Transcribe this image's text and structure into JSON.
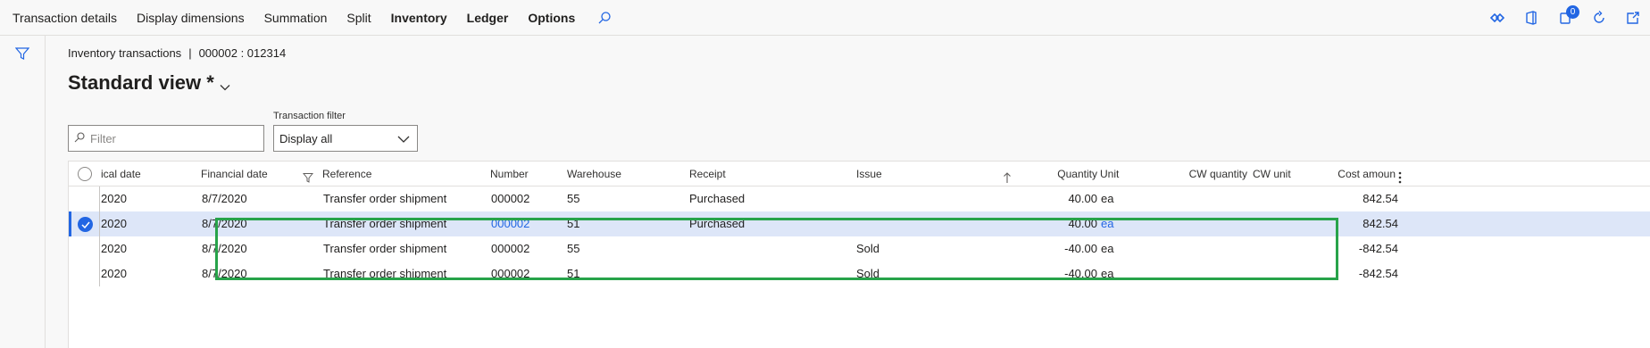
{
  "actionbar": {
    "tabs": [
      {
        "label": "Transaction details",
        "bold": false
      },
      {
        "label": "Display dimensions",
        "bold": false
      },
      {
        "label": "Summation",
        "bold": false
      },
      {
        "label": "Split",
        "bold": false
      },
      {
        "label": "Inventory",
        "bold": true
      },
      {
        "label": "Ledger",
        "bold": true
      },
      {
        "label": "Options",
        "bold": true
      }
    ],
    "search_icon": "search-icon",
    "right_icons": [
      "diamond-arrows-icon",
      "office-icon",
      "notifications-icon",
      "refresh-icon",
      "open-new-window-icon"
    ],
    "notification_count": "0"
  },
  "rail": {
    "icon": "filter-icon"
  },
  "breadcrumb": {
    "section": "Inventory transactions",
    "separator": "|",
    "record": "000002 : 012314"
  },
  "view": {
    "title": "Standard view *"
  },
  "filter": {
    "placeholder": "Filter"
  },
  "transaction_filter": {
    "label": "Transaction filter",
    "value": "Display all"
  },
  "grid": {
    "columns": {
      "physical_date": "ical date",
      "financial_date": "Financial date",
      "reference": "Reference",
      "number": "Number",
      "warehouse": "Warehouse",
      "receipt": "Receipt",
      "issue": "Issue",
      "quantity": "Quantity",
      "unit": "Unit",
      "cw_quantity": "CW quantity",
      "cw_unit": "CW unit",
      "cost_amount": "Cost amoun"
    },
    "rows": [
      {
        "physical_date": "2020",
        "financial_date": "8/7/2020",
        "reference": "Transfer order shipment",
        "number": "000002",
        "warehouse": "55",
        "receipt": "Purchased",
        "issue": "",
        "quantity": "40.00",
        "unit": "ea",
        "cost_amount": "842.54",
        "selected": false
      },
      {
        "physical_date": "2020",
        "financial_date": "8/7/2020",
        "reference": "Transfer order shipment",
        "number": "000002",
        "warehouse": "51",
        "receipt": "Purchased",
        "issue": "",
        "quantity": "40.00",
        "unit": "ea",
        "cost_amount": "842.54",
        "selected": true
      },
      {
        "physical_date": "2020",
        "financial_date": "8/7/2020",
        "reference": "Transfer order shipment",
        "number": "000002",
        "warehouse": "55",
        "receipt": "",
        "issue": "Sold",
        "quantity": "-40.00",
        "unit": "ea",
        "cost_amount": "-842.54",
        "selected": false
      },
      {
        "physical_date": "2020",
        "financial_date": "8/7/2020",
        "reference": "Transfer order shipment",
        "number": "000002",
        "warehouse": "51",
        "receipt": "",
        "issue": "Sold",
        "quantity": "-40.00",
        "unit": "ea",
        "cost_amount": "-842.54",
        "selected": false
      }
    ]
  },
  "colors": {
    "accent": "#2266e3",
    "highlight_box": "#27a34a",
    "selected_row": "#dde6f8"
  }
}
